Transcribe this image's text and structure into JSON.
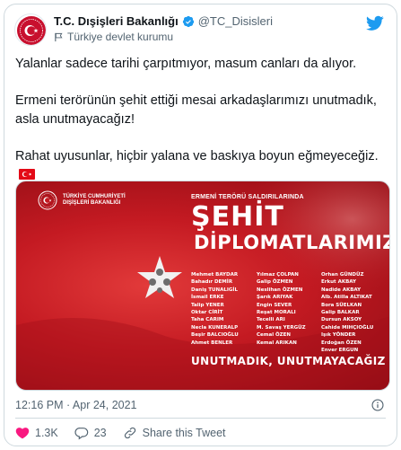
{
  "account": {
    "name": "T.C. Dışişleri Bakanlığı",
    "handle": "@TC_Disisleri",
    "label": "Türkiye devlet kurumu"
  },
  "tweet": {
    "paragraphs": [
      "Yalanlar sadece tarihi çarpıtmıyor, masum canları da alıyor.",
      "Ermeni terörünün şehit ettiği mesai arkadaşlarımızı unutmadık, asla unutmayacağız!",
      "Rahat uyusunlar, hiçbir yalana  ve baskıya boyun eğmeyeceğiz."
    ],
    "emoji": "turkey-flag-icon"
  },
  "media": {
    "ministry_line1": "TÜRKİYE CUMHURİYETİ",
    "ministry_line2": "DIŞİŞLERİ BAKANLIĞI",
    "subtitle": "ERMENİ TERÖRÜ SALDIRILARINDA",
    "title1": "ŞEHİT",
    "title2": "DİPLOMATLARIMIZ",
    "names_col1": [
      "Mehmet BAYDAR",
      "Bahadır DEMİR",
      "Daniş TUNALIGİL",
      "İsmail ERKE",
      "Talip YENER",
      "Oktar CİRİT",
      "Taha CARIM",
      "Necla KUNERALP",
      "Beşir BALCIOĞLU",
      "Ahmet BENLER"
    ],
    "names_col2": [
      "Yılmaz ÇOLPAN",
      "Galip ÖZMEN",
      "Neslihan ÖZMEN",
      "Şarık ARIYAK",
      "Engin SEVER",
      "Reşat MORALI",
      "Tecelli ARI",
      "M. Savaş YERGÜZ",
      "Cemal ÖZEN",
      "Kemal ARIKAN"
    ],
    "names_col3": [
      "Orhan GÜNDÜZ",
      "Erkut AKBAY",
      "Nadide AKBAY",
      "Alb. Atilla ALTIKAT",
      "Bora SÜELKAN",
      "Galip BALKAR",
      "Dursun AKSOY",
      "Cahide MIHÇIOĞLU",
      "Işık YÖNDER",
      "Erdoğan ÖZEN",
      "Enver ERGUN"
    ],
    "slogan": "UNUTMADIK, UNUTMAYACAĞIZ"
  },
  "footer": {
    "timestamp": "12:16 PM · Apr 24, 2021",
    "likes": "1.3K",
    "replies": "23",
    "share": "Share this Tweet"
  },
  "colors": {
    "accent": "#1d9bf0",
    "like": "#f91880",
    "flag_red": "#e30a17",
    "muted": "#536471"
  }
}
